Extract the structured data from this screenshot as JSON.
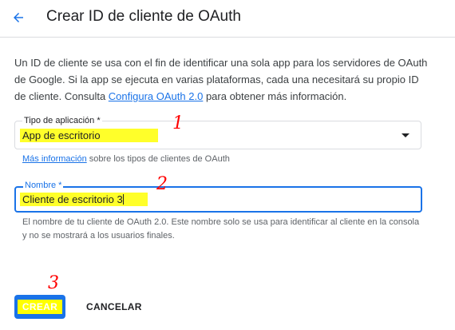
{
  "header": {
    "title": "Crear ID de cliente de OAuth",
    "back_icon": "arrow-back-icon"
  },
  "description": {
    "text_before": "Un ID de cliente se usa con el fin de identificar una sola app para los servidores de OAuth de Google. Si la app se ejecuta en varias plataformas, cada una necesitará su propio ID de cliente. Consulta ",
    "link": "Configura OAuth 2.0",
    "text_after": " para obtener más información."
  },
  "app_type": {
    "label": "Tipo de aplicación *",
    "value": "App de escritorio",
    "hint_link": "Más información",
    "hint_text": " sobre los tipos de clientes de OAuth"
  },
  "name_field": {
    "label": "Nombre *",
    "value": "Cliente de escritorio 3",
    "hint": "El nombre de tu cliente de OAuth 2.0. Este nombre solo se usa para identificar al cliente en la consola y no se mostrará a los usuarios finales."
  },
  "actions": {
    "create_label": "CREAR",
    "cancel_label": "CANCELAR"
  },
  "annotations": {
    "one": "1",
    "two": "2",
    "three": "3"
  },
  "colors": {
    "accent": "#1a73e8",
    "highlight": "#ffff2a",
    "annotation": "#ff0000"
  }
}
